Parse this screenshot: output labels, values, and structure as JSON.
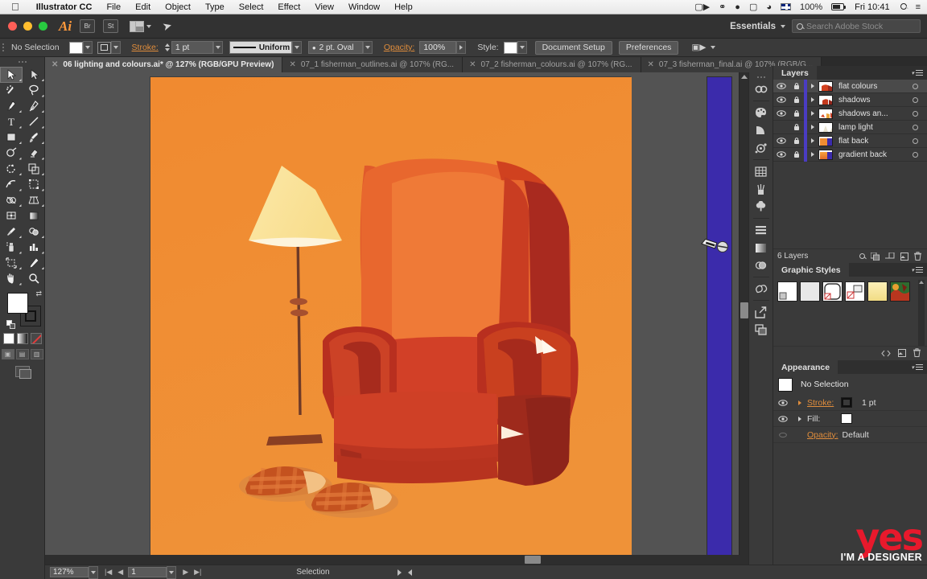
{
  "menubar": {
    "apple_icon": "apple-icon",
    "app_name": "Illustrator CC",
    "items": [
      "File",
      "Edit",
      "Object",
      "Type",
      "Select",
      "Effect",
      "View",
      "Window",
      "Help"
    ],
    "status_icons": [
      "screen-record-icon",
      "creative-cloud-icon",
      "dropbox-icon",
      "airplay-icon",
      "wifi-icon"
    ],
    "language_flag": "uk-flag-icon",
    "battery_percent": "100%",
    "clock": "Fri 10:41",
    "search_icon": "spotlight-search-icon",
    "notification_icon": "notification-center-icon"
  },
  "titlebar": {
    "logo": "Ai",
    "bridge_label": "Br",
    "stock_label": "St",
    "arrange_icon": "arrange-documents-icon",
    "sync_icon": "cc-libraries-icon",
    "workspace": "Essentials",
    "search_placeholder": "Search Adobe Stock",
    "search_icon": "search-icon"
  },
  "controlbar": {
    "selection_label": "No Selection",
    "fill_swatch": "#ffffff",
    "stroke_label": "Stroke:",
    "stroke_weight": "1 pt",
    "stroke_profile": "Uniform",
    "brush_definition": "2 pt. Oval",
    "opacity_label": "Opacity:",
    "opacity_value": "100%",
    "style_label": "Style:",
    "doc_setup": "Document Setup",
    "preferences": "Preferences",
    "align_icon": "align-to-selection-icon"
  },
  "tabs": [
    {
      "title": "06 lighting and colours.ai* @ 127% (RGB/GPU Preview)",
      "active": true
    },
    {
      "title": "07_1 fisherman_outlines.ai @ 107% (RG...",
      "active": false
    },
    {
      "title": "07_2 fisherman_colours.ai @ 107% (RG...",
      "active": false
    },
    {
      "title": "07_3 fisherman_final.ai @ 107% (RGB/G...",
      "active": false
    }
  ],
  "toolbar": {
    "tools": [
      {
        "name": "selection-tool",
        "selected": true
      },
      {
        "name": "direct-selection-tool",
        "selected": false
      },
      {
        "name": "magic-wand-tool",
        "selected": false
      },
      {
        "name": "lasso-tool",
        "selected": false
      },
      {
        "name": "pen-tool",
        "selected": false
      },
      {
        "name": "curvature-tool",
        "selected": false
      },
      {
        "name": "type-tool",
        "selected": false
      },
      {
        "name": "line-segment-tool",
        "selected": false
      },
      {
        "name": "rectangle-tool",
        "selected": false
      },
      {
        "name": "paintbrush-tool",
        "selected": false
      },
      {
        "name": "shaper-tool",
        "selected": false
      },
      {
        "name": "eraser-tool",
        "selected": false
      },
      {
        "name": "rotate-tool",
        "selected": false
      },
      {
        "name": "scale-tool",
        "selected": false
      },
      {
        "name": "width-tool",
        "selected": false
      },
      {
        "name": "free-transform-tool",
        "selected": false
      },
      {
        "name": "shape-builder-tool",
        "selected": false
      },
      {
        "name": "perspective-grid-tool",
        "selected": false
      },
      {
        "name": "mesh-tool",
        "selected": false
      },
      {
        "name": "gradient-tool",
        "selected": false
      },
      {
        "name": "eyedropper-tool",
        "selected": false
      },
      {
        "name": "blend-tool",
        "selected": false
      },
      {
        "name": "symbol-sprayer-tool",
        "selected": false
      },
      {
        "name": "column-graph-tool",
        "selected": false
      },
      {
        "name": "artboard-tool",
        "selected": false
      },
      {
        "name": "slice-tool",
        "selected": false
      },
      {
        "name": "hand-tool",
        "selected": false
      },
      {
        "name": "zoom-tool",
        "selected": false
      }
    ],
    "fill_color": "#ffffff",
    "stroke_color": "#1a1a1a",
    "color_modes": [
      "solid-color-mode",
      "gradient-mode",
      "none-mode"
    ],
    "draw_modes": [
      "draw-normal",
      "draw-behind",
      "draw-inside"
    ],
    "screen_mode": "change-screen-mode"
  },
  "canvas": {
    "artboard_bg": "#ef8c32",
    "side_strip_color": "#3b2bab",
    "cursor_icon": "pen-tool-cursor-no-drop",
    "artwork_title": "armchair-lamp-slippers-illustration"
  },
  "rail": {
    "icons": [
      "link-icon",
      "color-icon",
      "color-guide-icon",
      "color-themes-icon",
      "artboards-icon",
      "brushes-icon",
      "symbols-icon",
      "align-icon",
      "gradient-icon",
      "transparency-icon",
      "cc-libraries-icon",
      "export-icon",
      "layers-icon"
    ]
  },
  "layers_panel": {
    "title": "Layers",
    "menu_icon": "panel-menu-icon",
    "rows": [
      {
        "name": "flat colours",
        "visible": true,
        "locked": true,
        "color": "#4a3cc2",
        "selected": true,
        "thumb": "thumb-chair-red"
      },
      {
        "name": "shadows",
        "visible": true,
        "locked": true,
        "color": "#4a3cc2",
        "selected": false,
        "thumb": "thumb-shadows"
      },
      {
        "name": "shadows an...",
        "visible": true,
        "locked": true,
        "color": "#4a3cc2",
        "selected": false,
        "thumb": "thumb-shadows-2"
      },
      {
        "name": "lamp light",
        "visible": false,
        "locked": true,
        "color": "#4a3cc2",
        "selected": false,
        "thumb": "thumb-lamp-light"
      },
      {
        "name": "flat back",
        "visible": true,
        "locked": true,
        "color": "#4a3cc2",
        "selected": false,
        "thumb": "thumb-flat-back"
      },
      {
        "name": "gradient back",
        "visible": true,
        "locked": true,
        "color": "#4a3cc2",
        "selected": false,
        "thumb": "thumb-gradient-back"
      }
    ],
    "footer_count": "6 Layers",
    "footer_icons": [
      "locate-object-icon",
      "make-clipping-mask-icon",
      "create-new-sublayer-icon",
      "create-new-layer-icon",
      "delete-selection-icon"
    ]
  },
  "graphic_styles_panel": {
    "title": "Graphic Styles",
    "menu_icon": "panel-menu-icon",
    "swatches": [
      {
        "name": "default-style",
        "color": "#ffffff"
      },
      {
        "name": "plain-white-style",
        "color": "#e8e8e8"
      },
      {
        "name": "rounded-no-fill-style",
        "color": "#ffffff"
      },
      {
        "name": "split-style",
        "color": "#ffffff"
      },
      {
        "name": "yellow-gradient-style",
        "color": "#f3e39a"
      },
      {
        "name": "multicolour-art-style",
        "color": "#2f6b2f"
      }
    ],
    "footer_icons": [
      "break-link-icon",
      "new-graphic-style-icon",
      "delete-graphic-style-icon"
    ]
  },
  "appearance_panel": {
    "title": "Appearance",
    "menu_icon": "panel-menu-icon",
    "selection_label": "No Selection",
    "rows": [
      {
        "label": "Stroke:",
        "value": "1 pt",
        "swatch": "#3a3a3a",
        "visible": true,
        "accent": true
      },
      {
        "label": "Fill:",
        "value": "",
        "swatch": "#ffffff",
        "visible": true,
        "accent": false
      },
      {
        "label": "Opacity:",
        "value": "Default",
        "swatch": null,
        "visible": false,
        "accent": true
      }
    ]
  },
  "watermark": {
    "line1": "yes",
    "line2": "I'M A DESIGNER",
    "color": "#e8192c"
  },
  "statusbar": {
    "zoom": "127%",
    "page": "1",
    "status_text": "Selection",
    "first_icon": "first-artboard-icon",
    "prev_icon": "previous-artboard-icon",
    "next_icon": "next-artboard-icon",
    "last_icon": "last-artboard-icon"
  }
}
